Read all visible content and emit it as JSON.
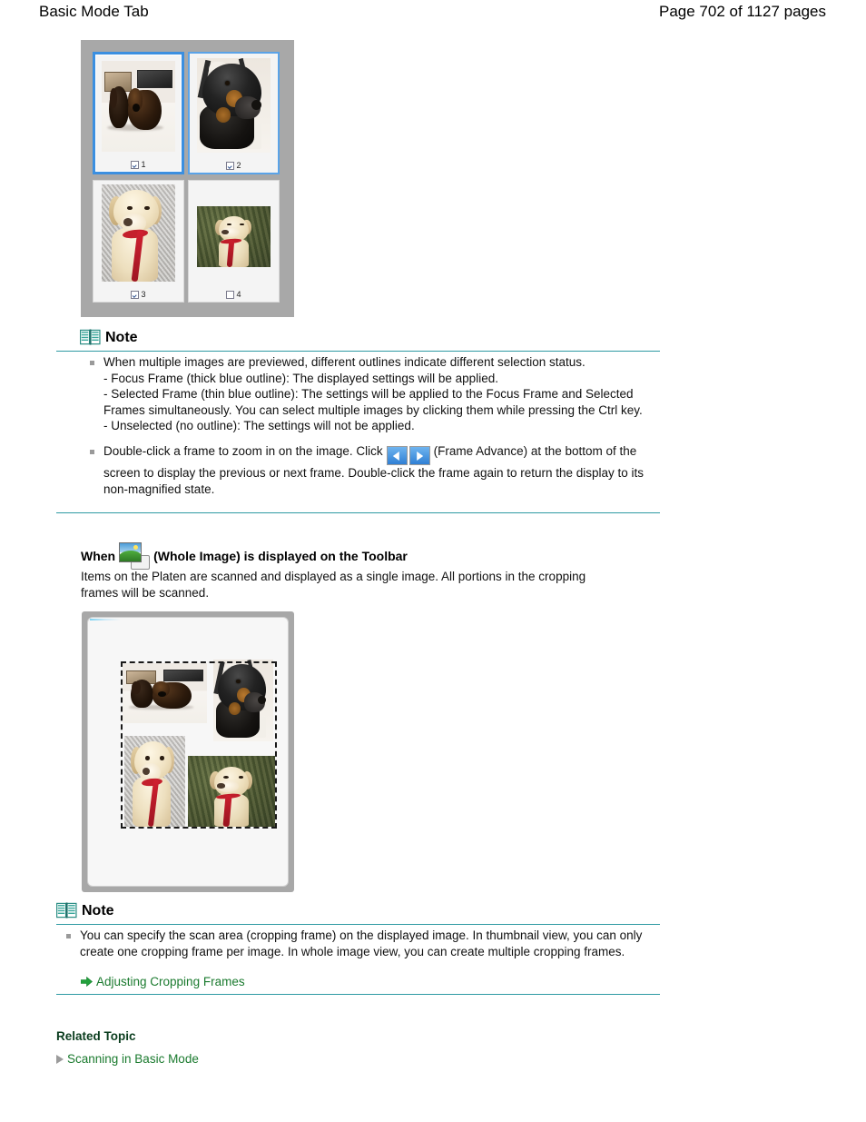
{
  "header": {
    "title": "Basic Mode Tab",
    "page_indicator": "Page 702 of 1127 pages"
  },
  "thumbnail_panel": {
    "name": "thumbnail-preview-panel",
    "frames": [
      {
        "number": "1",
        "checked": true,
        "outline": "focus",
        "alt": "Two dark dachshunds lying on a pale floor"
      },
      {
        "number": "2",
        "checked": true,
        "outline": "selected",
        "alt": "Close-up of a black and tan dachshund head"
      },
      {
        "number": "3",
        "checked": true,
        "outline": "none",
        "alt": "Cream labrador with red leash on gravel"
      },
      {
        "number": "4",
        "checked": false,
        "outline": "none",
        "alt": "Cream dog with red leash on dark grass"
      }
    ]
  },
  "note1": {
    "title": "Note",
    "icon": "open-book-icon",
    "bullets": [
      {
        "lines": [
          "When multiple images are previewed, different outlines indicate different selection status.",
          "- Focus Frame (thick blue outline): The displayed settings will be applied.",
          "- Selected Frame (thin blue outline): The settings will be applied to the Focus Frame and Selected Frames simultaneously. You can select multiple images by clicking them while pressing the Ctrl key.",
          "- Unselected (no outline): The settings will not be applied."
        ]
      },
      {
        "text_before": "Double-click a frame to zoom in on the image. Click",
        "buttons": [
          {
            "name": "frame-advance-previous-button",
            "glyph": "left-triangle"
          },
          {
            "name": "frame-advance-next-button",
            "glyph": "right-triangle"
          }
        ],
        "text_after": "(Frame Advance) at the bottom of the screen to display the previous or next frame. Double-click the frame again to return the display to its non-magnified state."
      }
    ]
  },
  "when_section": {
    "prefix": "When",
    "icon": "whole-image-icon",
    "suffix": "(Whole Image) is displayed on the Toolbar",
    "paragraph": "Items on the Platen are scanned and displayed as a single image. All portions in the cropping frames will be scanned."
  },
  "whole_image_panel": {
    "name": "whole-image-preview-panel",
    "cropping_frame": "dashed-cropping-frame",
    "photos": [
      {
        "alt": "Two dark dachshunds lying on a pale floor"
      },
      {
        "alt": "Close-up of a black and tan dachshund head"
      },
      {
        "alt": "Cream labrador with red leash on gravel"
      },
      {
        "alt": "Cream dog with red leash on dark grass"
      }
    ]
  },
  "note2": {
    "title": "Note",
    "icon": "open-book-icon",
    "bullet": "You can specify the scan area (cropping frame) on the displayed image. In thumbnail view, you can only create one cropping frame per image. In whole image view, you can create multiple cropping frames.",
    "link": "Adjusting Cropping Frames"
  },
  "related_topic": {
    "heading": "Related Topic",
    "link": "Scanning in Basic Mode"
  },
  "colors": {
    "rule": "#2e9aa3",
    "link_green": "#1a7a2e",
    "focus_blue": "#3b8fe0",
    "selected_blue": "#5aa3e8",
    "panel_grey": "#a8a8a8"
  }
}
